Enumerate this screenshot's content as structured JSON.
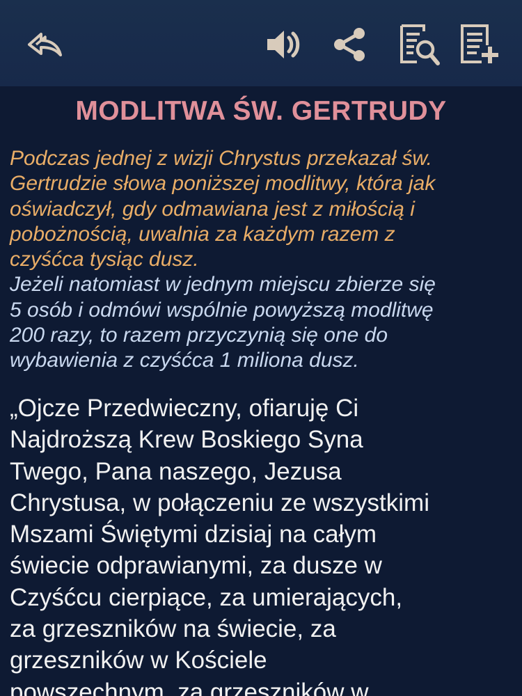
{
  "toolbar": {
    "back_icon": "reply-arrow-icon",
    "sound_icon": "speaker-icon",
    "share_icon": "share-icon",
    "search_icon": "document-search-icon",
    "add_icon": "document-add-icon",
    "icon_color": "#d8cbbb"
  },
  "title": "MODLITWA ŚW. GERTRUDY",
  "intro_orange": [
    "Podczas jednej z wizji Chrystus przekazał św.",
    "Gertrudzie słowa poniższej modlitwy, która jak",
    "oświadczył, gdy odmawiana jest z miłością i",
    "pobożnością, uwalnia za każdym razem z",
    "czyśćca tysiąc dusz."
  ],
  "intro_blue": [
    "Jeżeli natomiast w jednym miejscu zbierze się",
    "5 osób i odmówi wspólnie powyższą modlitwę",
    "200 razy, to razem przyczynią się one do",
    "wybawienia z czyśćca 1 miliona dusz."
  ],
  "prayer": [
    "„Ojcze Przedwieczny, ofiaruję Ci",
    "Najdroższą Krew Boskiego Syna",
    "Twego, Pana naszego, Jezusa",
    "Chrystusa, w połączeniu ze wszystkimi",
    "Mszami Świętymi dzisiaj na całym",
    "świecie odprawianymi, za dusze w",
    "Czyśćcu cierpiące, za umierających,",
    "za grzeszników na świecie, za",
    "grzeszników w Kościele",
    "powszechnym, za grzeszników w"
  ],
  "colors": {
    "toolbar_bg": "#1a2f4d",
    "content_bg": "#0e1a33",
    "title": "#e0909a",
    "intro_orange": "#e9ad67",
    "intro_blue": "#c9d8ef",
    "prayer_text": "#f1f1f1"
  }
}
